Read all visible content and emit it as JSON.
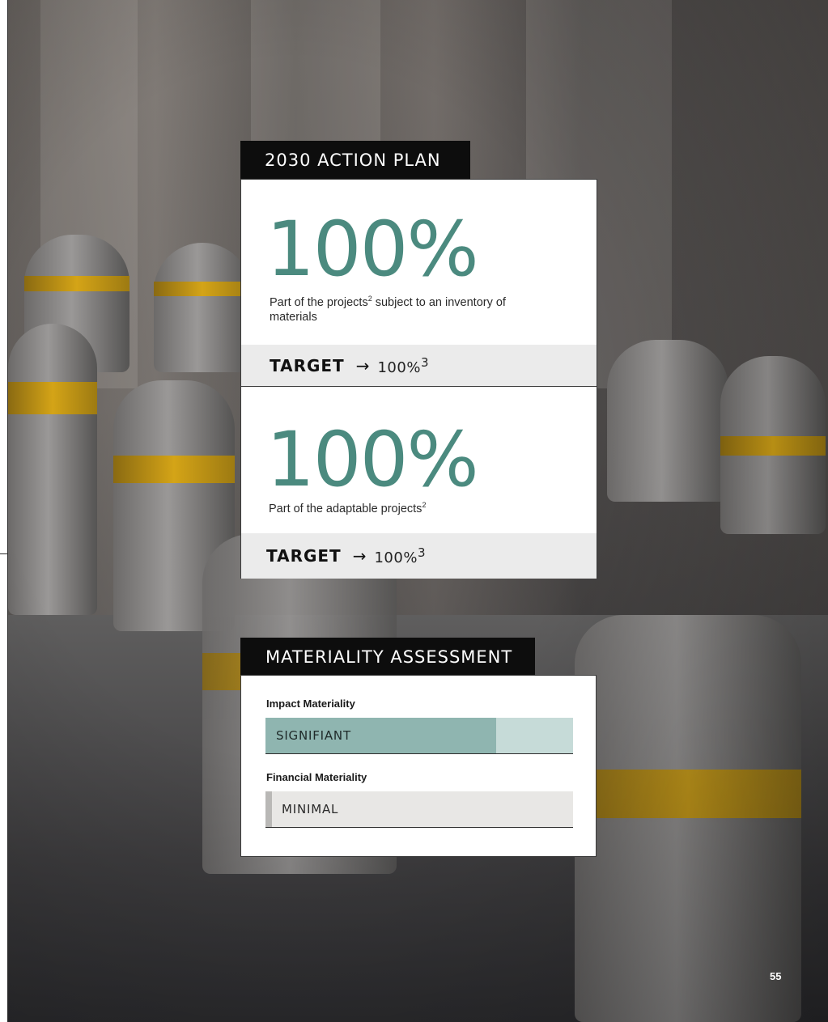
{
  "action_plan": {
    "header": "2030 ACTION PLAN",
    "kpis": [
      {
        "value": "100%",
        "description": "Part of the projects",
        "description_sup": "2",
        "description_tail": " subject to an inventory of materials",
        "target_label": "TARGET",
        "target_arrow": "→",
        "target_value": "100%",
        "target_sup": "3"
      },
      {
        "value": "100%",
        "description": "Part of the adaptable projects",
        "description_sup": "2",
        "description_tail": "",
        "target_label": "TARGET",
        "target_arrow": "→",
        "target_value": "100%",
        "target_sup": "3"
      }
    ]
  },
  "materiality": {
    "header": "MATERIALITY ASSESSMENT",
    "items": [
      {
        "label": "Impact Materiality",
        "level": "SIGNIFIANT",
        "fill_percent": 75
      },
      {
        "label": "Financial Materiality",
        "level": "MINIMAL",
        "fill_percent": 2
      }
    ],
    "colors": {
      "impact_fill": "#8fb5b0",
      "impact_track": "#c6dbd8",
      "financial_track": "#e8e7e5",
      "accent": "#4b8a7f"
    }
  },
  "page_number": "55"
}
